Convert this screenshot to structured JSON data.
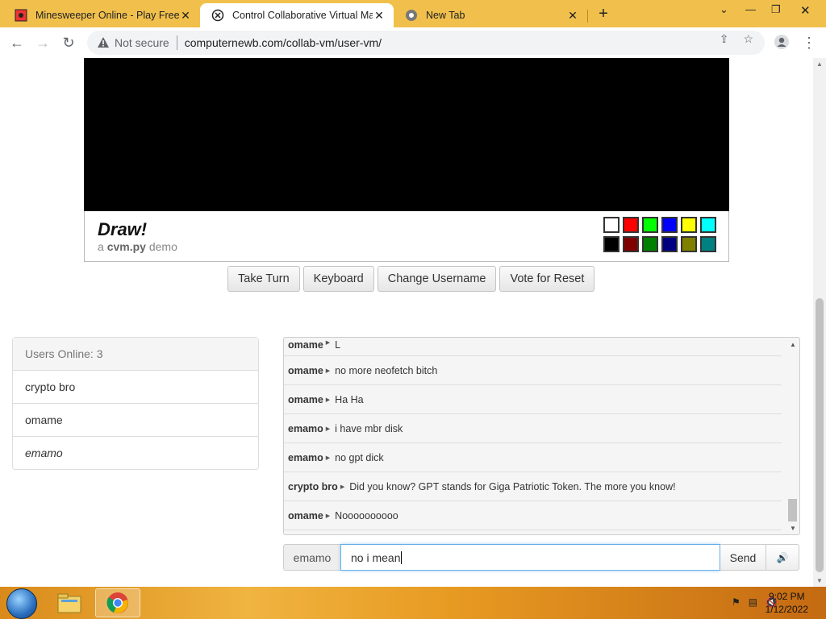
{
  "browser": {
    "tabs": [
      {
        "title": "Minesweeper Online - Play Free O",
        "icon": "minesweeper-favicon"
      },
      {
        "title": "Control Collaborative Virtual Ma",
        "icon": "cvm-favicon"
      },
      {
        "title": "New Tab",
        "icon": "chrome-favicon"
      }
    ],
    "security_label": "Not secure",
    "url": "computernewb.com/collab-vm/user-vm/"
  },
  "vm": {
    "title": "Draw!",
    "subtitle_prefix": "a",
    "subtitle_brand": "cvm.py",
    "subtitle_suffix": "demo",
    "palette": [
      "#ffffff",
      "#ff0000",
      "#00ff00",
      "#0000ff",
      "#ffff00",
      "#00ffff",
      "#000000",
      "#800000",
      "#008000",
      "#000080",
      "#808000",
      "#008080"
    ]
  },
  "actions": {
    "take_turn": "Take Turn",
    "keyboard": "Keyboard",
    "change_username": "Change Username",
    "vote_reset": "Vote for Reset"
  },
  "users": {
    "header": "Users Online: 3",
    "list": [
      "crypto bro",
      "omame",
      "emamo"
    ]
  },
  "chat": {
    "messages": [
      {
        "user": "omame",
        "text": "L"
      },
      {
        "user": "omame",
        "text": "no more neofetch bitch"
      },
      {
        "user": "omame",
        "text": "Ha Ha"
      },
      {
        "user": "emamo",
        "text": "i have mbr disk"
      },
      {
        "user": "emamo",
        "text": "no gpt dick"
      },
      {
        "user": "crypto bro",
        "text": "Did you know? GPT stands for Giga Patriotic Token. The more you know!"
      },
      {
        "user": "omame",
        "text": "Noooooooooo"
      }
    ],
    "username": "emamo",
    "input_value": "no i mean",
    "send_label": "Send"
  },
  "taskbar": {
    "time": "9:02 PM",
    "date": "1/12/2022"
  }
}
